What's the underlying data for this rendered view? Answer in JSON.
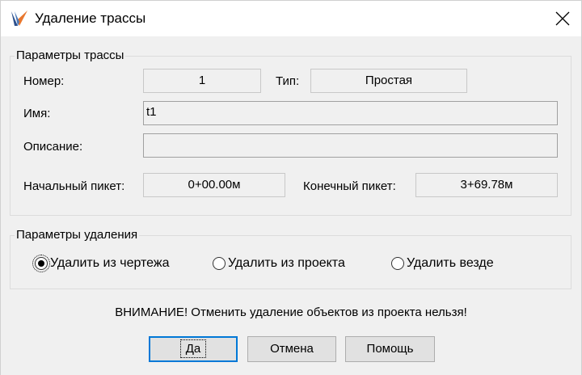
{
  "window": {
    "title": "Удаление трассы",
    "icon": "app-logo-icon",
    "close_icon": "close-icon"
  },
  "route_params": {
    "legend": "Параметры трассы",
    "number_label": "Номер:",
    "number_value": "1",
    "type_label": "Тип:",
    "type_value": "Простая",
    "name_label": "Имя:",
    "name_value": "t1",
    "description_label": "Описание:",
    "description_value": "",
    "start_label": "Начальный пикет:",
    "start_value": "0+00.00м",
    "end_label": "Конечный пикет:",
    "end_value": "3+69.78м"
  },
  "delete_params": {
    "legend": "Параметры удаления",
    "options": [
      {
        "label": "Удалить из чертежа",
        "checked": true
      },
      {
        "label": "Удалить из проекта",
        "checked": false
      },
      {
        "label": "Удалить везде",
        "checked": false
      }
    ]
  },
  "warning": "ВНИМАНИЕ! Отменить удаление объектов из проекта нельзя!",
  "buttons": {
    "ok": "Да",
    "cancel": "Отмена",
    "help": "Помощь"
  },
  "colors": {
    "accent": "#0078d7",
    "logo_orange": "#e8772e",
    "logo_blue": "#2b4f8c"
  }
}
